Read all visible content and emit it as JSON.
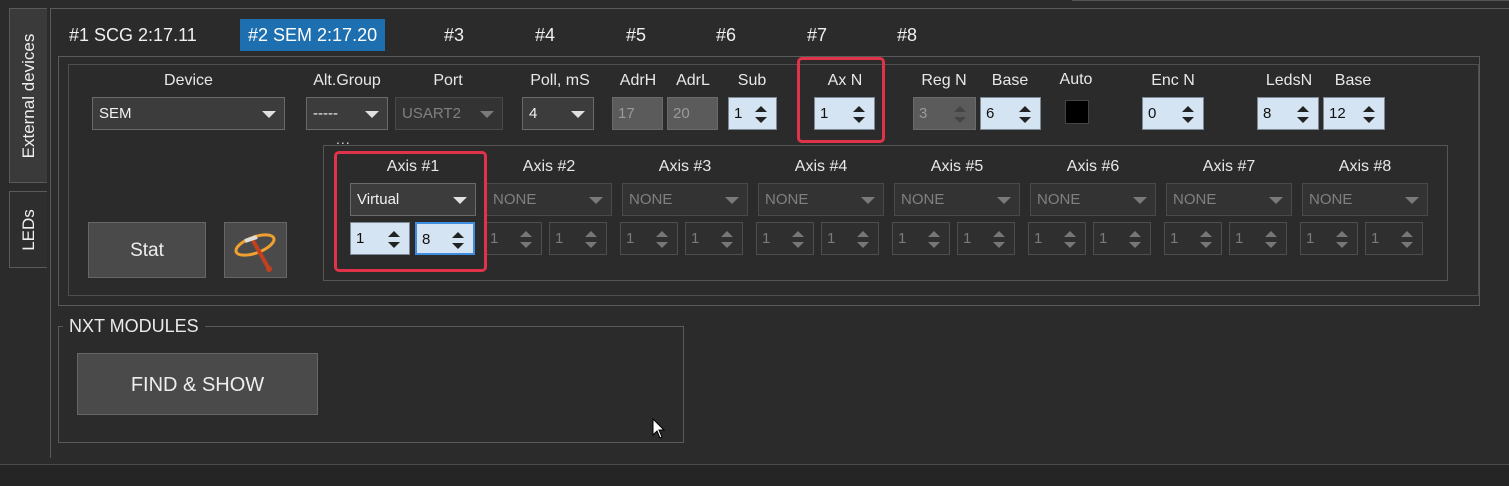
{
  "left_tabs": [
    "External devices",
    "LEDs"
  ],
  "device_tabs": [
    "#1 SCG 2:17.11",
    "#2 SEM 2:17.20",
    "#3",
    "#4",
    "#5",
    "#6",
    "#7",
    "#8"
  ],
  "headers": {
    "device": "Device",
    "alt_group": "Alt.Group",
    "port": "Port",
    "poll": "Poll, mS",
    "adrh": "AdrH",
    "adrl": "AdrL",
    "sub": "Sub",
    "ax_n": "Ax N",
    "reg_n": "Reg N",
    "base": "Base",
    "auto": "Auto",
    "enc_n": "Enc N",
    "leds_n": "LedsN",
    "leds_base": "Base"
  },
  "values": {
    "device": "SEM",
    "alt_group": "-----",
    "port": "USART2",
    "poll": "4",
    "adrh": "17",
    "adrl": "20",
    "sub": "1",
    "ax_n": "1",
    "reg_n": "3",
    "base": "6",
    "enc_n": "0",
    "leds_n": "8",
    "leds_base": "12"
  },
  "dots": "...",
  "axes": [
    {
      "label": "Axis #1",
      "mode": "Virtual",
      "a": "1",
      "b": "8"
    },
    {
      "label": "Axis #2",
      "mode": "NONE",
      "a": "1",
      "b": "1"
    },
    {
      "label": "Axis #3",
      "mode": "NONE",
      "a": "1",
      "b": "1"
    },
    {
      "label": "Axis #4",
      "mode": "NONE",
      "a": "1",
      "b": "1"
    },
    {
      "label": "Axis #5",
      "mode": "NONE",
      "a": "1",
      "b": "1"
    },
    {
      "label": "Axis #6",
      "mode": "NONE",
      "a": "1",
      "b": "1"
    },
    {
      "label": "Axis #7",
      "mode": "NONE",
      "a": "1",
      "b": "1"
    },
    {
      "label": "Axis #8",
      "mode": "NONE",
      "a": "1",
      "b": "1"
    }
  ],
  "buttons": {
    "stat": "Stat",
    "find_show": "FIND &  SHOW"
  },
  "nxt_title": "NXT MODULES",
  "colors": {
    "active_tab": "#1d6fb0",
    "highlight": "#e0334a",
    "spin_bg": "#d4e4f2"
  }
}
